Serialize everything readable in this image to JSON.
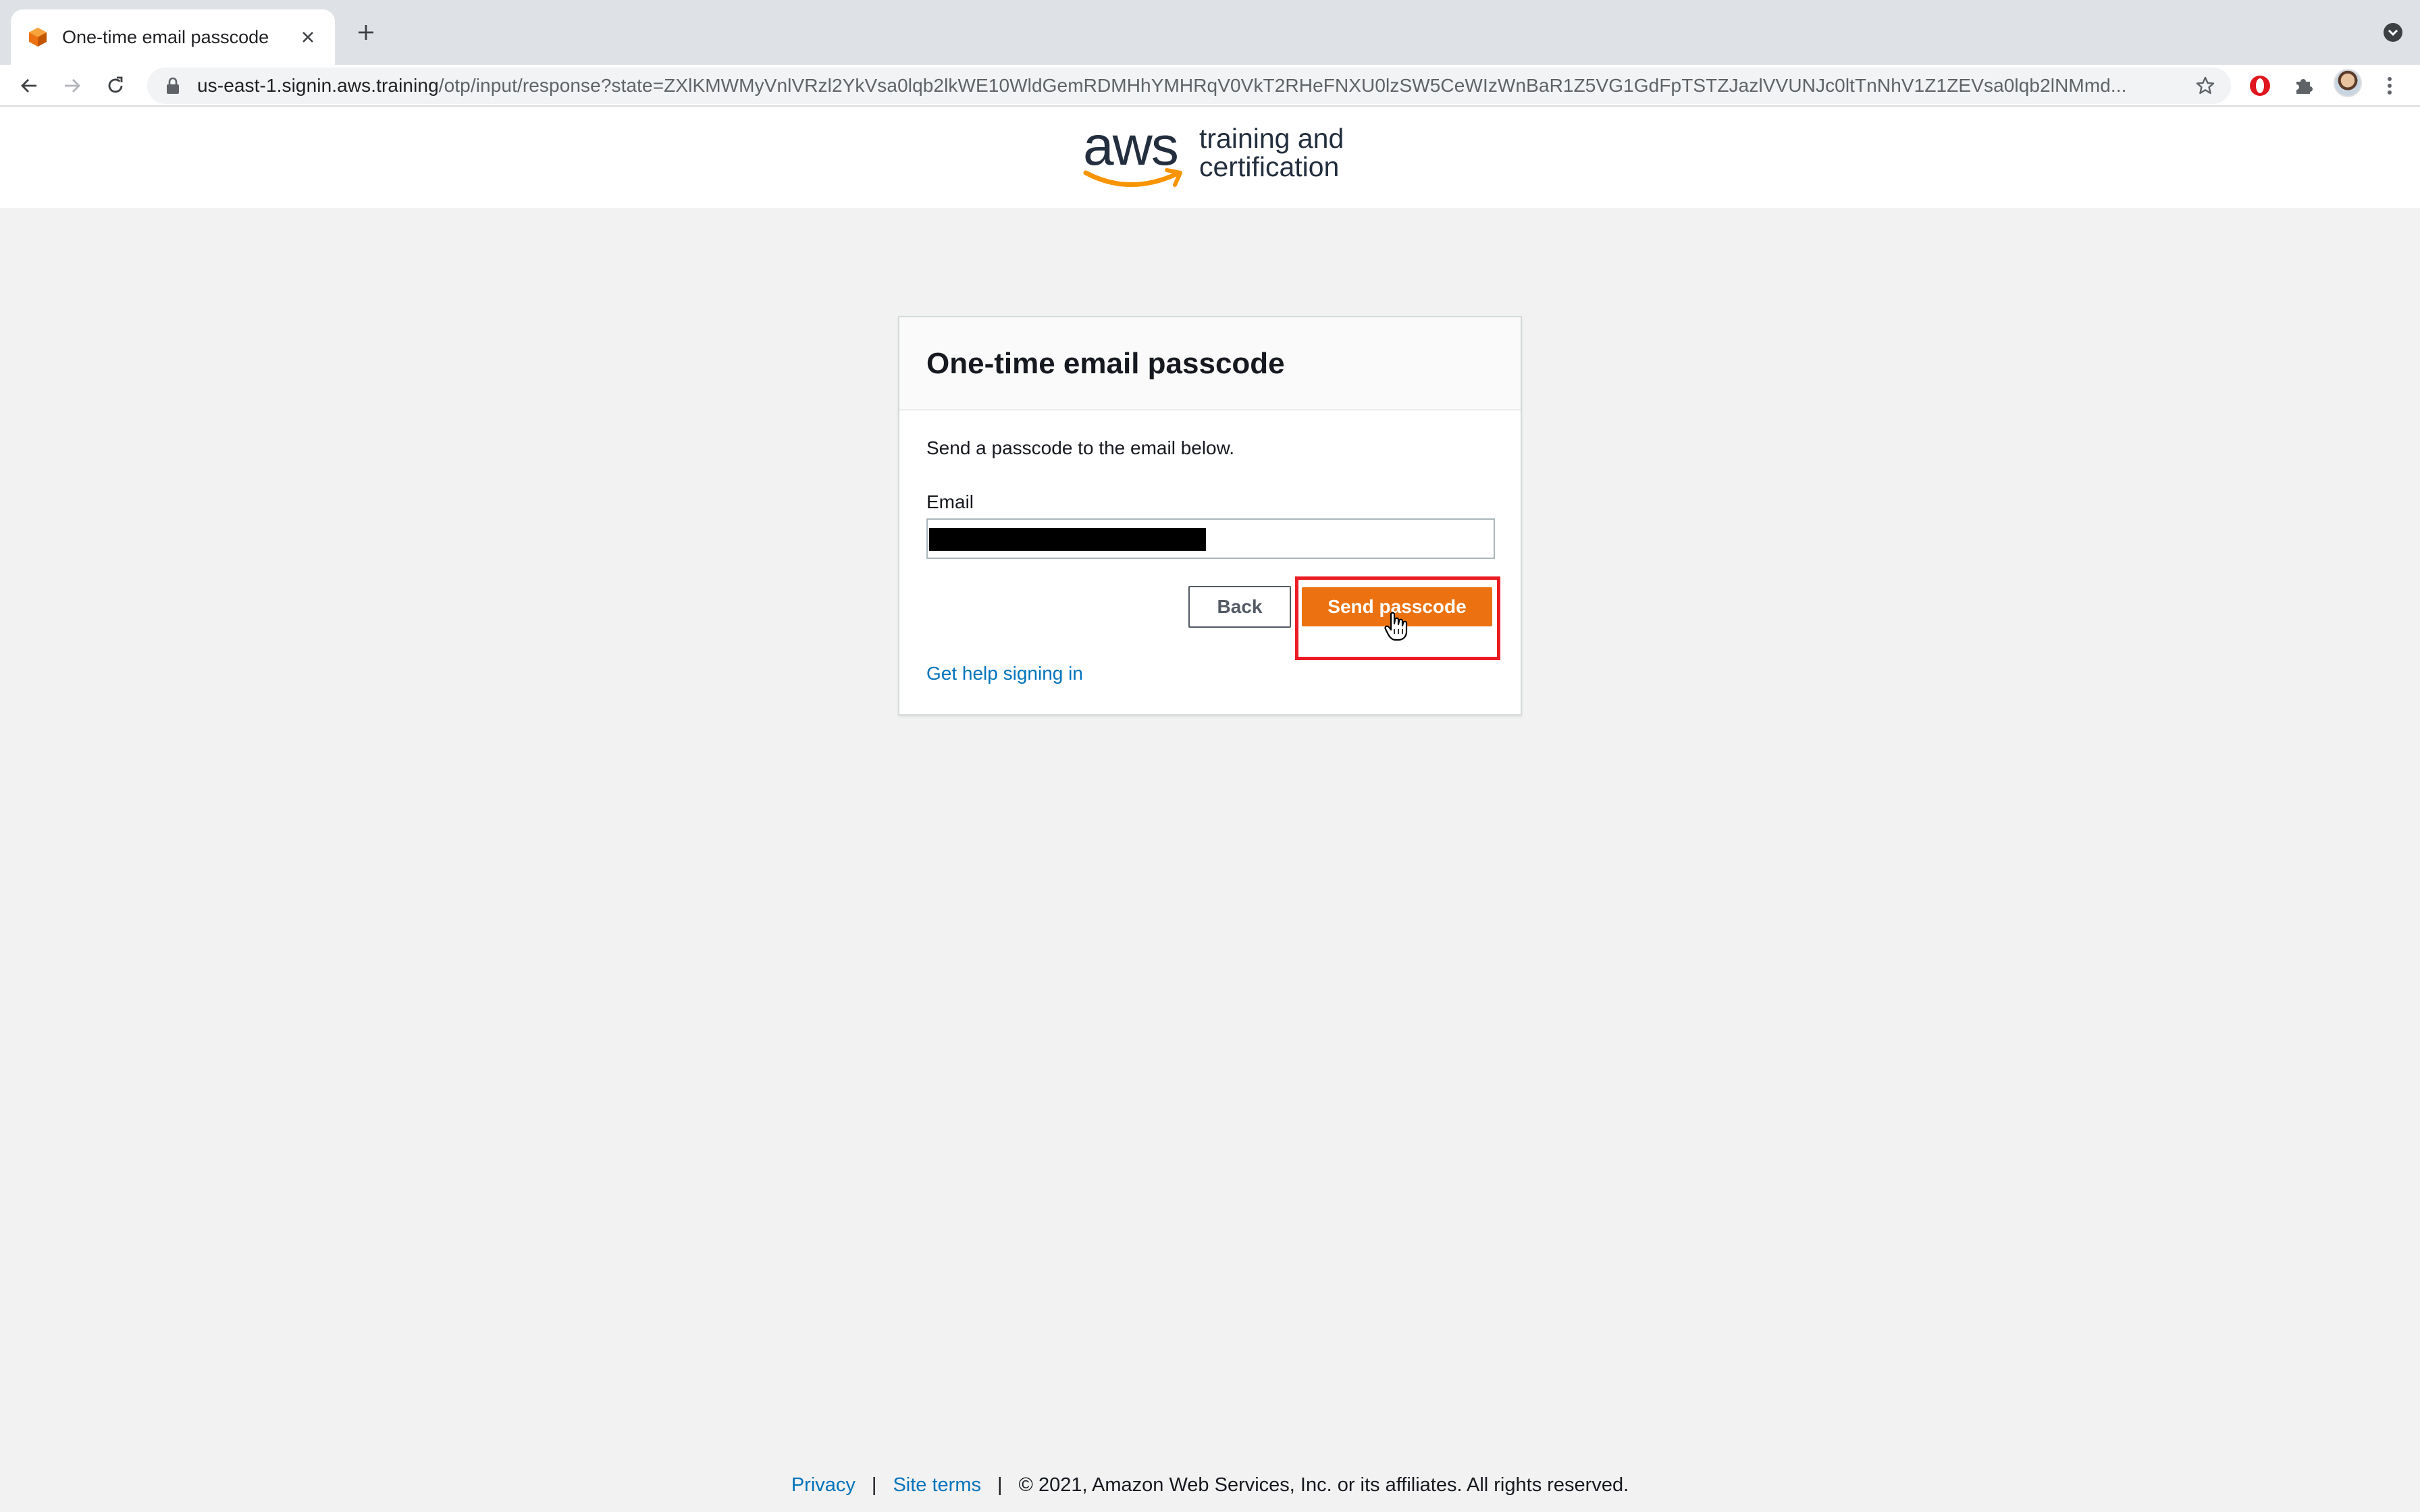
{
  "browser": {
    "tab_title": "One-time email passcode",
    "url_host": "us-east-1.signin.aws.training",
    "url_path": "/otp/input/response?state=ZXlKMWMyVnlVRzl2YkVsa0lqb2lkWE10WldGemRDMHhYMHRqV0VkT2RHeFNXU0lzSW5CeWIzWnBaR1Z5VG1GdFpTSTZJazlVVUNJc0ltTnNhV1Z1ZEVsa0lqb2lNMmd..."
  },
  "header": {
    "logo_wordmark": "aws",
    "logo_line1": "training and",
    "logo_line2": "certification"
  },
  "card": {
    "title": "One-time email passcode",
    "instructions": "Send a passcode to the email below.",
    "email_label": "Email",
    "back_label": "Back",
    "send_label": "Send passcode",
    "help_link": "Get help signing in"
  },
  "footer": {
    "privacy": "Privacy",
    "sep1": "|",
    "site_terms": "Site terms",
    "sep2": "|",
    "copyright": "© 2021, Amazon Web Services, Inc. or its affiliates. All rights reserved."
  },
  "colors": {
    "accent": "#ec7211",
    "link": "#0073bb",
    "highlight": "#ec1c24"
  }
}
